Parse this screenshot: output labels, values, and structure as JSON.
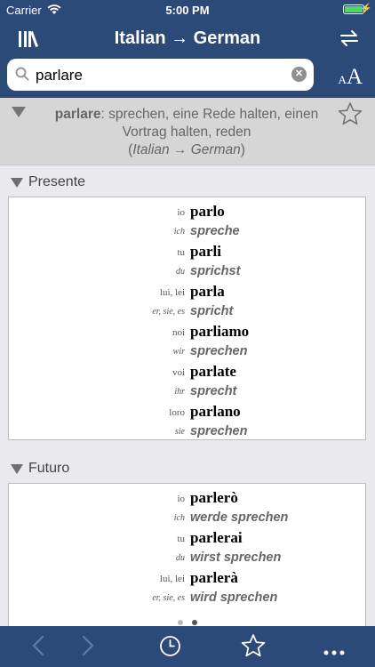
{
  "status": {
    "carrier": "Carrier",
    "time": "5:00 PM"
  },
  "nav": {
    "title": "Italian → German",
    "library_icon": "library-icon",
    "swap_icon": "swap-icon"
  },
  "search": {
    "value": "parlare",
    "placeholder": "Search",
    "font_size_small": "A",
    "font_size_large": "A"
  },
  "entry": {
    "headword": "parlare",
    "definition": ": sprechen, eine Rede halten, einen Vortrag halten, reden",
    "lang_open": "(",
    "lang": "Italian → German",
    "lang_close": ")"
  },
  "sections": [
    {
      "title": "Presente",
      "rows": [
        {
          "pron": "io",
          "form": "parlo"
        },
        {
          "pron_de": "ich",
          "trans": "spreche"
        },
        {
          "pron": "tu",
          "form": "parli"
        },
        {
          "pron_de": "du",
          "trans": "sprichst"
        },
        {
          "pron": "lui, lei",
          "form": "parla"
        },
        {
          "pron_de": "er, sie, es",
          "trans": "spricht"
        },
        {
          "pron": "noi",
          "form": "parliamo"
        },
        {
          "pron_de": "wir",
          "trans": "sprechen"
        },
        {
          "pron": "voi",
          "form": "parlate"
        },
        {
          "pron_de": "ihr",
          "trans": "sprecht"
        },
        {
          "pron": "loro",
          "form": "parlano"
        },
        {
          "pron_de": "sie",
          "trans": "sprechen"
        }
      ]
    },
    {
      "title": "Futuro",
      "rows": [
        {
          "pron": "io",
          "form": "parlerò"
        },
        {
          "pron_de": "ich",
          "trans": "werde sprechen"
        },
        {
          "pron": "tu",
          "form": "parlerai"
        },
        {
          "pron_de": "du",
          "trans": "wirst sprechen"
        },
        {
          "pron": "lui, lei",
          "form": "parlerà"
        },
        {
          "pron_de": "er, sie, es",
          "trans": "wird sprechen"
        }
      ]
    }
  ],
  "page_dots": {
    "count": 2,
    "active": 1
  },
  "colors": {
    "bar": "#2c4a78",
    "background": "#e9e9ee",
    "entry_bg": "#d6d6d6"
  },
  "toolbar": {
    "back_icon": "chevron-left-icon",
    "forward_icon": "chevron-right-icon",
    "history_icon": "clock-icon",
    "favorite_icon": "star-icon",
    "more_icon": "more-icon"
  }
}
